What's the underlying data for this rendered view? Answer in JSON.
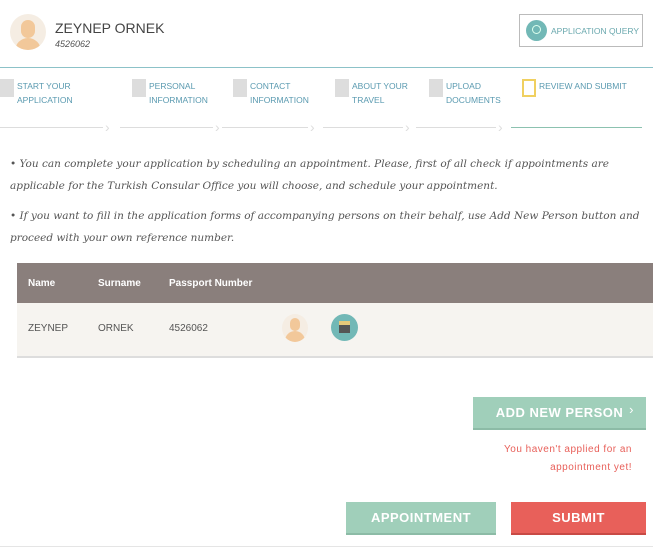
{
  "user": {
    "name": "ZEYNEP ORNEK",
    "id": "4526062"
  },
  "header": {
    "query_label": "APPLICATION QUERY"
  },
  "steps": [
    {
      "l1": "START YOUR",
      "l2": "APPLICATION",
      "icon": "form-icon"
    },
    {
      "l1": "PERSONAL",
      "l2": "INFORMATION",
      "icon": "document-icon"
    },
    {
      "l1": "CONTACT",
      "l2": "INFORMATION",
      "icon": "pages-icon"
    },
    {
      "l1": "ABOUT YOUR",
      "l2": "TRAVEL",
      "icon": "calendar-icon"
    },
    {
      "l1": "UPLOAD",
      "l2": "DOCUMENTS",
      "icon": "upload-document-icon"
    },
    {
      "l1": "REVIEW AND SUBMIT",
      "l2": "",
      "icon": "checkbox-icon"
    }
  ],
  "info": {
    "p1": "• You can complete your application by scheduling an appointment. Please, first of all check if appointments are applicable for the Turkish Consular Office you will choose, and schedule your appointment.",
    "p2": "•   If you want to fill in the application forms of accompanying persons on their behalf, use Add New Person button and proceed with your own reference number."
  },
  "table": {
    "headers": [
      "Name",
      "Surname",
      "Passport Number"
    ],
    "rows": [
      {
        "name": "ZEYNEP",
        "surname": "ORNEK",
        "passport": "4526062"
      }
    ]
  },
  "actions": {
    "add_person": "ADD NEW PERSON",
    "warning_l1": "You haven't applied for an",
    "warning_l2": "appointment yet!",
    "appointment": "APPOINTMENT",
    "submit": "SUBMIT"
  },
  "colors": {
    "teal": "#72b8b6",
    "green": "#a0cfba",
    "red": "#e8605a",
    "table_header": "#8a7f7c"
  }
}
